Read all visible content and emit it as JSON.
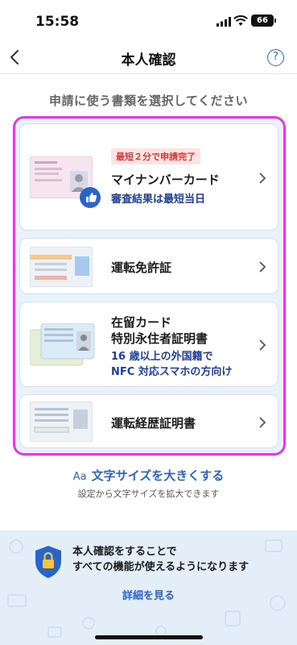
{
  "status": {
    "time": "15:58",
    "battery": "66"
  },
  "nav": {
    "title": "本人確認",
    "help_icon": "question-circle-icon",
    "back_icon": "chevron-left-icon"
  },
  "instruction": "申請に使う書類を選択してください",
  "documents": [
    {
      "badge": "最短２分で申請完了",
      "name": "マイナンバーカード",
      "sub": "審査結果は最短当日"
    },
    {
      "name": "運転免許証"
    },
    {
      "name_line1": "在留カード",
      "name_line2": "特別永住者証明書",
      "sub_line1": "16 歳以上の外国籍で",
      "sub_line2": "NFC 対応スマホの方向け"
    },
    {
      "name": "運転経歴証明書"
    }
  ],
  "text_size": {
    "icon": "Aa",
    "label": "文字サイズを大きくする",
    "note": "設定から文字サイズを拡大できます"
  },
  "promo": {
    "line1": "本人確認をすることで",
    "line2": "すべての機能が使えるようになります",
    "link": "詳細を見る"
  },
  "colors": {
    "accent": "#2b64c8",
    "highlight": "#e03be0",
    "badge_text": "#d93a3a"
  }
}
